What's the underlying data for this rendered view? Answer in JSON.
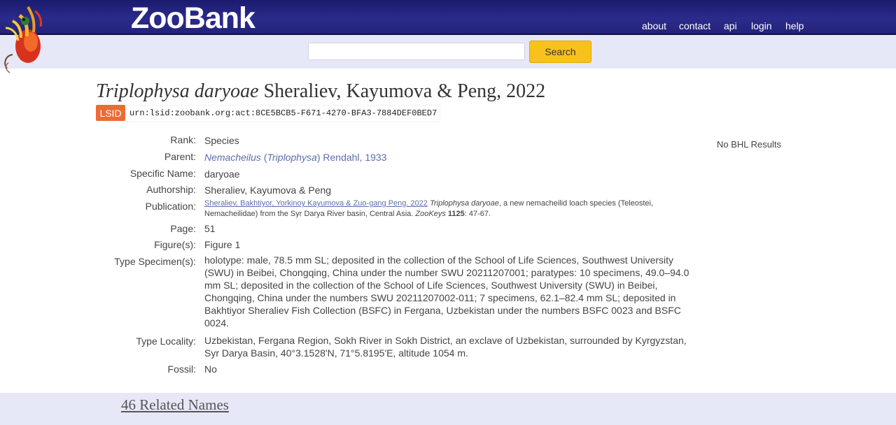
{
  "header": {
    "logo": "ZooBank",
    "nav": [
      "about",
      "contact",
      "api",
      "login",
      "help"
    ]
  },
  "search": {
    "value": "",
    "button": "Search"
  },
  "record": {
    "title_italic": "Triplophysa daryoae",
    "title_rest": " Sheraliev, Kayumova & Peng, 2022",
    "lsid_label": "LSID",
    "lsid": "urn:lsid:zoobank.org:act:8CE5BCB5-F671-4270-BFA3-7884DEF0BED7",
    "fields": {
      "rank": {
        "label": "Rank:",
        "value": "Species"
      },
      "parent": {
        "label": "Parent:",
        "genus": "Nemacheilus",
        "open": " (",
        "subgenus": "Triplophysa",
        "close": ")",
        "author": " Rendahl, 1933"
      },
      "specific_name": {
        "label": "Specific Name:",
        "value": "daryoae"
      },
      "authorship": {
        "label": "Authorship:",
        "value": "Sheraliev, Kayumova & Peng"
      },
      "publication": {
        "label": "Publication:",
        "authors": "Sheraliev, Bakhtiyor, Yorkinoy Kayumova & Zuo-gang Peng. 2022",
        "title_italic": "Triplophysa daryoae",
        "title_rest": ", a new nemacheilid loach species (Teleostei, Nemacheilidae) from the Syr Darya River basin, Central Asia.",
        "journal": "ZooKeys",
        "volume": "1125",
        "pages": ": 47-67."
      },
      "page": {
        "label": "Page:",
        "value": "51"
      },
      "figures": {
        "label": "Figure(s):",
        "value": "Figure 1"
      },
      "type_specimens": {
        "label": "Type Specimen(s):",
        "value": "holotype: male, 78.5 mm SL; deposited in the collection of the School of Life Sciences, Southwest University (SWU) in Beibei, Chongqing, China under the number SWU 20211207001; paratypes: 10 specimens, 49.0–94.0 mm SL; deposited in the collection of the School of Life Sciences, Southwest University (SWU) in Beibei, Chongqing, China under the numbers SWU 20211207002-011; 7 specimens, 62.1–82.4 mm SL; deposited in Bakhtiyor Sheraliev Fish Collection (BSFC) in Fergana, Uzbekistan under the numbers BSFC 0023 and BSFC 0024."
      },
      "type_locality": {
        "label": "Type Locality:",
        "value": "Uzbekistan, Fergana Region, Sokh River in Sokh District, an exclave of Uzbekistan, surrounded by Kyrgyzstan, Syr Darya Basin, 40°3.1528'N, 71°5.8195'E, altitude 1054 m."
      },
      "fossil": {
        "label": "Fossil:",
        "value": "No"
      }
    },
    "bhl": "No BHL Results",
    "related": "46 Related Names"
  },
  "colors": {
    "header_bg": "#2b2b8c",
    "search_button": "#f8c21c",
    "lsid_badge": "#ee6a35",
    "link": "#5b6eaa"
  }
}
